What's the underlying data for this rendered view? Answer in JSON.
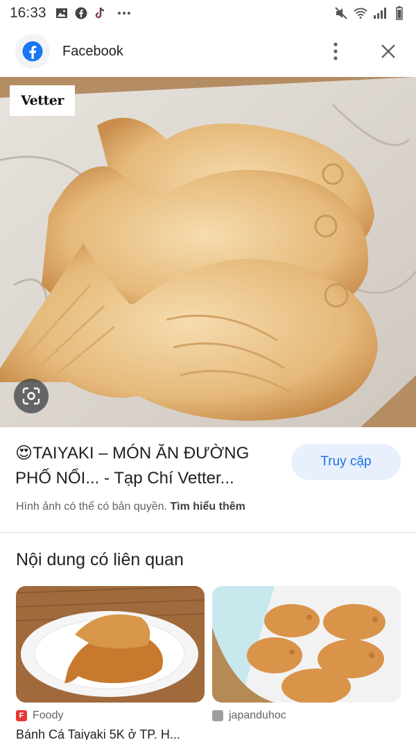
{
  "status_bar": {
    "time": "16:33",
    "left_icons": [
      "image-icon",
      "facebook-icon",
      "tiktok-icon",
      "more-dots-icon"
    ],
    "right_icons": [
      "mute-icon",
      "wifi-icon",
      "signal-icon",
      "battery-icon"
    ]
  },
  "header": {
    "title": "Facebook",
    "icon": "facebook-logo-icon",
    "actions": [
      "more-vert-icon",
      "close-icon"
    ]
  },
  "main_image": {
    "description_icon": "lens-icon",
    "watermark": "Vetter"
  },
  "result": {
    "emoji": "😍",
    "title": "TAIYAKI – MÓN ĂN ĐƯỜNG PHỐ NỔI... - Tạp Chí Vetter...",
    "visit_label": "Truy cập",
    "copyright_text": "Hình ảnh có thể có bản quyền.",
    "learn_more": "Tìm hiểu thêm"
  },
  "related": {
    "heading": "Nội dung có liên quan",
    "cards": [
      {
        "source": "Foody",
        "source_color": "#e53935",
        "title": "Bánh Cá Taiyaki 5K ở TP. H..."
      },
      {
        "source": "japanduhoc",
        "source_color": "#9e9e9e",
        "title": ""
      }
    ]
  },
  "colors": {
    "accent": "#1a73e8",
    "facebook_blue": "#1877f2",
    "visit_bg": "#e8f0fe"
  }
}
